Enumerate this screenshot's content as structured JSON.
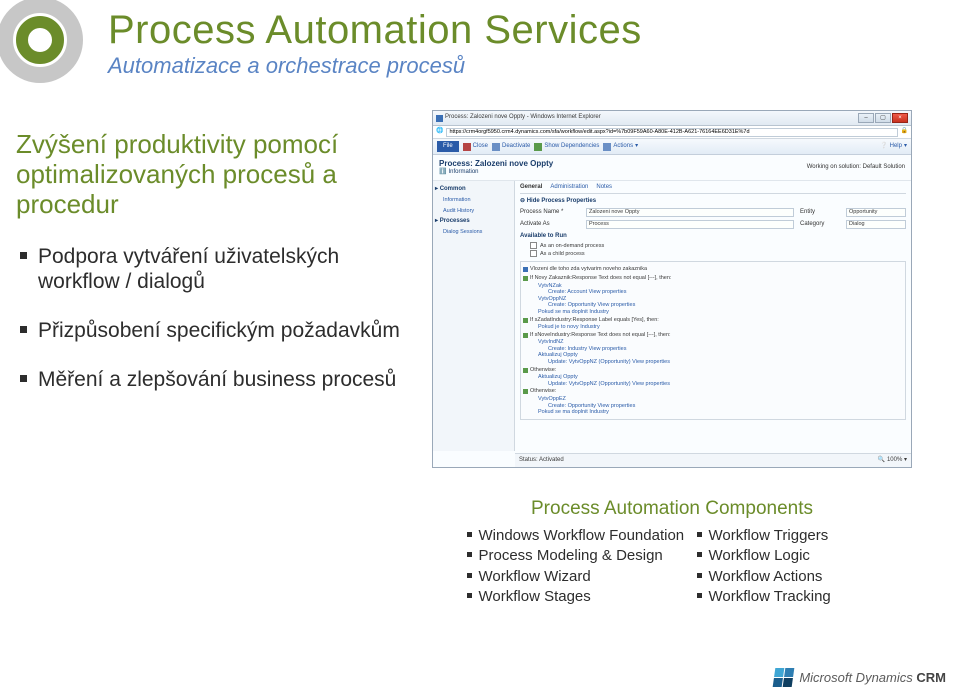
{
  "title": {
    "main": "Process Automation Services",
    "sub": "Automatizace a orchestrace procesů"
  },
  "left": {
    "heading": "Zvýšení produktivity pomocí optimalizovaných procesů a procedur",
    "bullets": [
      "Podpora vytváření uživatelských workflow / dialogů",
      "Přizpůsobení specifickým požadavkům",
      "Měření a zlepšování business procesů"
    ]
  },
  "shot": {
    "window_title": "Process: Zalozeni nove Oppty - Windows Internet Explorer",
    "url": "https://crm4orgf5950.crm4.dynamics.com/sfa/workflow/edit.aspx?id=%7b09F59A60-A80E-412B-A621-76164EE6D31E%7d",
    "ribbon": {
      "file": "File",
      "close": "Close",
      "deactivate": "Deactivate",
      "show_dep": "Show Dependencies",
      "actions": "Actions",
      "help": "Help"
    },
    "header": {
      "breadcrumb": "Process: Zalozeni nove Oppty",
      "subtitle": "Information",
      "working_on": "Working on solution: Default Solution"
    },
    "sidebar": {
      "groups": [
        {
          "title": "Common",
          "items": [
            "Information",
            "Audit History"
          ]
        },
        {
          "title": "Processes",
          "items": [
            "Dialog Sessions"
          ]
        }
      ]
    },
    "main_tabs": {
      "t1": "General",
      "t2": "Administration",
      "t3": "Notes"
    },
    "hide_props": "Hide Process Properties",
    "fields": {
      "process_name_label": "Process Name *",
      "process_name_value": "Zalozeni nove Oppty",
      "entity_label": "Entity",
      "entity_value": "Opportunity",
      "activate_as_label": "Activate As",
      "activate_as_value": "Process",
      "category_label": "Category",
      "category_value": "Dialog"
    },
    "available": {
      "title": "Available to Run",
      "ondemand": "As an on-demand process",
      "child": "As a child process"
    },
    "steps": [
      "Vlozeni dle toho zda vytvarim noveho zakaznika",
      "If Novy Zakaznik:Response Text does not equal [---], then:",
      "VytvNZak",
      "Create: Account View properties",
      "VytvOppNZ",
      "Create: Opportunity View properties",
      "Pokud se ma doplnit Industry",
      "If sZadatIndustry:Response Label equals [Yes], then:",
      "Pokud je to novy Industry",
      "If sNoveIndustry:Response Text does not equal [---], then:",
      "VytvIndNZ",
      "Create: Industry View properties",
      "Aktualizuj Oppty",
      "Update: VytvOppNZ (Opportunity) View properties",
      "Otherwise:",
      "Aktualizuj Oppty",
      "Update: VytvOppNZ (Opportunity) View properties",
      "Otherwise:",
      "VytvOppEZ",
      "Create: Opportunity View properties",
      "Pokud se ma doplnit Industry"
    ],
    "footer": {
      "status": "Status: Activated",
      "zoom": "100%"
    }
  },
  "components": {
    "title": "Process Automation Components",
    "left": [
      "Windows Workflow Foundation",
      "Process Modeling & Design",
      "Workflow Wizard",
      "Workflow Stages"
    ],
    "right": [
      "Workflow Triggers",
      "Workflow Logic",
      "Workflow Actions",
      "Workflow Tracking"
    ]
  },
  "footer_logo": {
    "brand": "Microsoft Dynamics",
    "product": "CRM"
  }
}
